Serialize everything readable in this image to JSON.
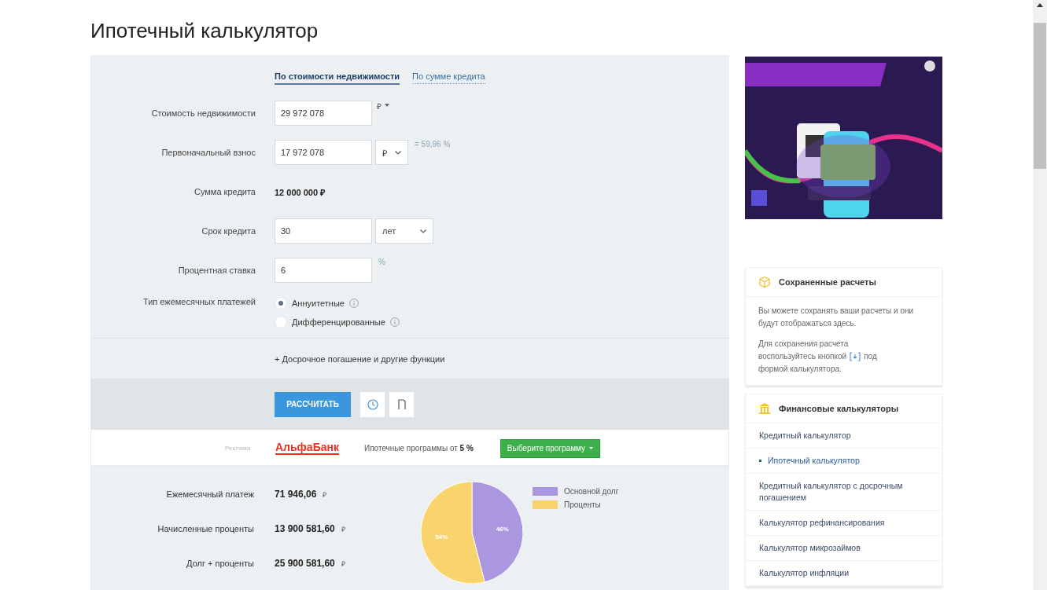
{
  "page": {
    "title": "Ипотечный калькулятор"
  },
  "calculator": {
    "tabs": [
      {
        "label": "По стоимости недвижимости",
        "selected": true
      },
      {
        "label": "По сумме кредита",
        "selected": false
      }
    ],
    "fields": [
      {
        "kind": "input",
        "label": "Стоимость недвижимости",
        "value": "29 972 078",
        "unit": {
          "kind": "menu",
          "text": "₽"
        }
      },
      {
        "kind": "input",
        "label": "Первоначальный взнос",
        "value": "17 972 078",
        "unit": {
          "kind": "select",
          "text": "₽"
        },
        "note": "= 59,96 %"
      },
      {
        "kind": "readout",
        "label": "Сумма кредита",
        "value": "12 000 000 ₽"
      },
      {
        "kind": "input",
        "label": "Срок кредита",
        "value": "30",
        "unit": {
          "kind": "select",
          "text": "лет"
        }
      },
      {
        "kind": "input",
        "label": "Процентная ставка",
        "value": "6",
        "unit": {
          "kind": "plain",
          "text": "%"
        }
      },
      {
        "kind": "radio",
        "label": "Тип ежемесячных платежей",
        "options": [
          {
            "label": "Аннуитетные",
            "selected": true
          },
          {
            "label": "Дифференцированные",
            "selected": false
          }
        ]
      }
    ],
    "more_link": "+ Досрочное погашение и другие функции",
    "calculate_button": "РАССЧИТАТЬ",
    "promo": {
      "label": "Реклама",
      "bank": "АльфаБанк",
      "text": "Ипотечные программы от **5 %**",
      "button": "Выберите программу"
    },
    "results": {
      "rows": [
        {
          "label": "Ежемесячный платеж",
          "value": "71 946,06",
          "unit": "₽"
        },
        {
          "label": "Начисленные проценты",
          "value": "13 900 581,60",
          "unit": "₽"
        },
        {
          "label": "Долг + проценты",
          "value": "25 900 581,60",
          "unit": "₽"
        }
      ],
      "chart_data": {
        "type": "pie",
        "categories": [
          "Основной долг",
          "Проценты"
        ],
        "values": [
          46,
          54
        ],
        "colors": [
          "#ab96e0",
          "#f9d36b"
        ],
        "data_labels": true,
        "value_labels": [
          "46%",
          "54%"
        ],
        "legend": "right"
      }
    }
  },
  "sidebar": {
    "saved": {
      "title": "Сохраненные расчеты",
      "text": "Вы можете сохранять ваши расчеты и они будут отображаться здесь.",
      "hint_before": [
        "Для сохранения расчета",
        "воспользуйтесь кнопкой"
      ],
      "hint_after": [
        "под",
        "формой калькулятора."
      ]
    },
    "calculators": {
      "title": "Финансовые калькуляторы",
      "items": [
        {
          "label": "Кредитный калькулятор",
          "selected": false
        },
        {
          "label": "Ипотечный калькулятор",
          "selected": true
        },
        {
          "label": "Кредитный калькулятор с досрочным погашением",
          "selected": false
        },
        {
          "label": "Калькулятор рефинансирования",
          "selected": false
        },
        {
          "label": "Калькулятор микрозаймов",
          "selected": false
        },
        {
          "label": "Калькулятор инфляции",
          "selected": false
        }
      ]
    }
  }
}
